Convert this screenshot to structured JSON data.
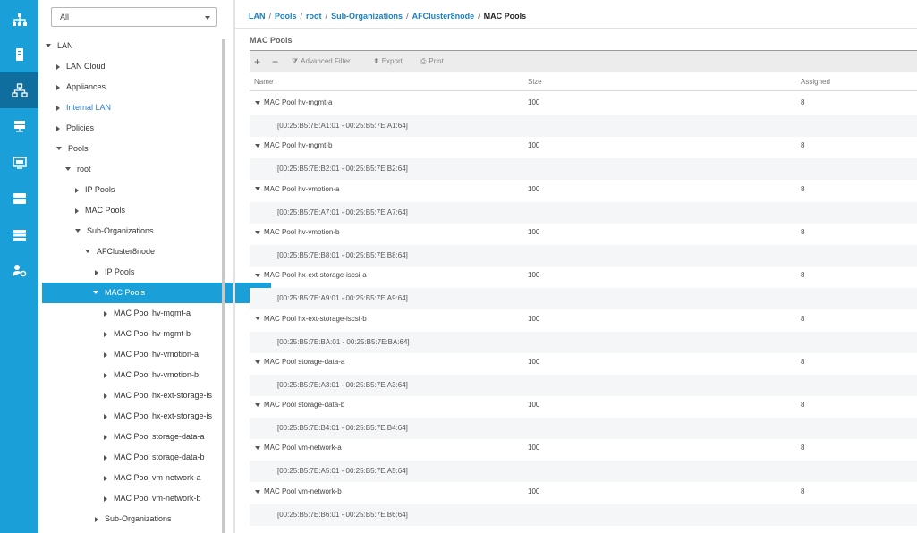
{
  "rail": {
    "items": [
      {
        "icon": "equipment-icon",
        "active": false
      },
      {
        "icon": "servers-icon",
        "active": false
      },
      {
        "icon": "lan-icon",
        "active": true
      },
      {
        "icon": "san-icon",
        "active": false
      },
      {
        "icon": "vm-icon",
        "active": false
      },
      {
        "icon": "storage-icon",
        "active": false
      },
      {
        "icon": "chassis-icon",
        "active": false
      },
      {
        "icon": "admin-icon",
        "active": false
      }
    ]
  },
  "filter": {
    "value": "All"
  },
  "tree": [
    {
      "label": "LAN",
      "arrow": "down",
      "selected": false,
      "blue": false
    },
    {
      "label": "LAN Cloud",
      "arrow": "right",
      "selected": false,
      "blue": false
    },
    {
      "label": "Appliances",
      "arrow": "right",
      "selected": false,
      "blue": false
    },
    {
      "label": "Internal LAN",
      "arrow": "right",
      "selected": false,
      "blue": true
    },
    {
      "label": "Policies",
      "arrow": "right",
      "selected": false,
      "blue": false
    },
    {
      "label": "Pools",
      "arrow": "down",
      "selected": false,
      "blue": false
    },
    {
      "label": "root",
      "arrow": "down",
      "selected": false,
      "blue": false
    },
    {
      "label": "IP Pools",
      "arrow": "right",
      "selected": false,
      "blue": false
    },
    {
      "label": "MAC Pools",
      "arrow": "right",
      "selected": false,
      "blue": false
    },
    {
      "label": "Sub-Organizations",
      "arrow": "down",
      "selected": false,
      "blue": false
    },
    {
      "label": "AFCluster8node",
      "arrow": "down",
      "selected": false,
      "blue": false
    },
    {
      "label": "IP Pools",
      "arrow": "right",
      "selected": false,
      "blue": false
    },
    {
      "label": "MAC Pools",
      "arrow": "down",
      "selected": true,
      "blue": false
    },
    {
      "label": "MAC Pool hv-mgmt-a",
      "arrow": "right",
      "selected": false,
      "blue": false
    },
    {
      "label": "MAC Pool hv-mgmt-b",
      "arrow": "right",
      "selected": false,
      "blue": false
    },
    {
      "label": "MAC Pool hv-vmotion-a",
      "arrow": "right",
      "selected": false,
      "blue": false
    },
    {
      "label": "MAC Pool hv-vmotion-b",
      "arrow": "right",
      "selected": false,
      "blue": false
    },
    {
      "label": "MAC Pool hx-ext-storage-is",
      "arrow": "right",
      "selected": false,
      "blue": false
    },
    {
      "label": "MAC Pool hx-ext-storage-is",
      "arrow": "right",
      "selected": false,
      "blue": false
    },
    {
      "label": "MAC Pool storage-data-a",
      "arrow": "right",
      "selected": false,
      "blue": false
    },
    {
      "label": "MAC Pool storage-data-b",
      "arrow": "right",
      "selected": false,
      "blue": false
    },
    {
      "label": "MAC Pool vm-network-a",
      "arrow": "right",
      "selected": false,
      "blue": false
    },
    {
      "label": "MAC Pool vm-network-b",
      "arrow": "right",
      "selected": false,
      "blue": false
    },
    {
      "label": "Sub-Organizations",
      "arrow": "right",
      "selected": false,
      "blue": false
    }
  ],
  "breadcrumb": {
    "items": [
      "LAN",
      "Pools",
      "root",
      "Sub-Organizations",
      "AFCluster8node"
    ],
    "current": "MAC Pools",
    "separator": "/"
  },
  "section_title": "MAC Pools",
  "toolbar": {
    "add": "+",
    "remove": "−",
    "advanced_filter": "Advanced Filter",
    "export": "Export",
    "print": "Print"
  },
  "table": {
    "columns": [
      "Name",
      "Size",
      "Assigned"
    ],
    "rows": [
      {
        "name": "MAC Pool hv-mgmt-a",
        "size": "100",
        "assigned": "8",
        "range": "[00:25:B5:7E:A1:01 - 00:25:B5:7E:A1:64]"
      },
      {
        "name": "MAC Pool hv-mgmt-b",
        "size": "100",
        "assigned": "8",
        "range": "[00:25:B5:7E:B2:01 - 00:25:B5:7E:B2:64]"
      },
      {
        "name": "MAC Pool hv-vmotion-a",
        "size": "100",
        "assigned": "8",
        "range": "[00:25:B5:7E:A7:01 - 00:25:B5:7E:A7:64]"
      },
      {
        "name": "MAC Pool hv-vmotion-b",
        "size": "100",
        "assigned": "8",
        "range": "[00:25:B5:7E:B8:01 - 00:25:B5:7E:B8:64]"
      },
      {
        "name": "MAC Pool hx-ext-storage-iscsi-a",
        "size": "100",
        "assigned": "8",
        "range": "[00:25:B5:7E:A9:01 - 00:25:B5:7E:A9:64]"
      },
      {
        "name": "MAC Pool hx-ext-storage-iscsi-b",
        "size": "100",
        "assigned": "8",
        "range": "[00:25:B5:7E:BA:01 - 00:25:B5:7E:BA:64]"
      },
      {
        "name": "MAC Pool storage-data-a",
        "size": "100",
        "assigned": "8",
        "range": "[00:25:B5:7E:A3:01 - 00:25:B5:7E:A3:64]"
      },
      {
        "name": "MAC Pool storage-data-b",
        "size": "100",
        "assigned": "8",
        "range": "[00:25:B5:7E:B4:01 - 00:25:B5:7E:B4:64]"
      },
      {
        "name": "MAC Pool vm-network-a",
        "size": "100",
        "assigned": "8",
        "range": "[00:25:B5:7E:A5:01 - 00:25:B5:7E:A5:64]"
      },
      {
        "name": "MAC Pool vm-network-b",
        "size": "100",
        "assigned": "8",
        "range": "[00:25:B5:7E:B6:01 - 00:25:B5:7E:B6:64]"
      }
    ]
  },
  "colors": {
    "accent": "#1a9fd8",
    "rail_active": "#0f6e9e",
    "link": "#1a7fc0"
  }
}
